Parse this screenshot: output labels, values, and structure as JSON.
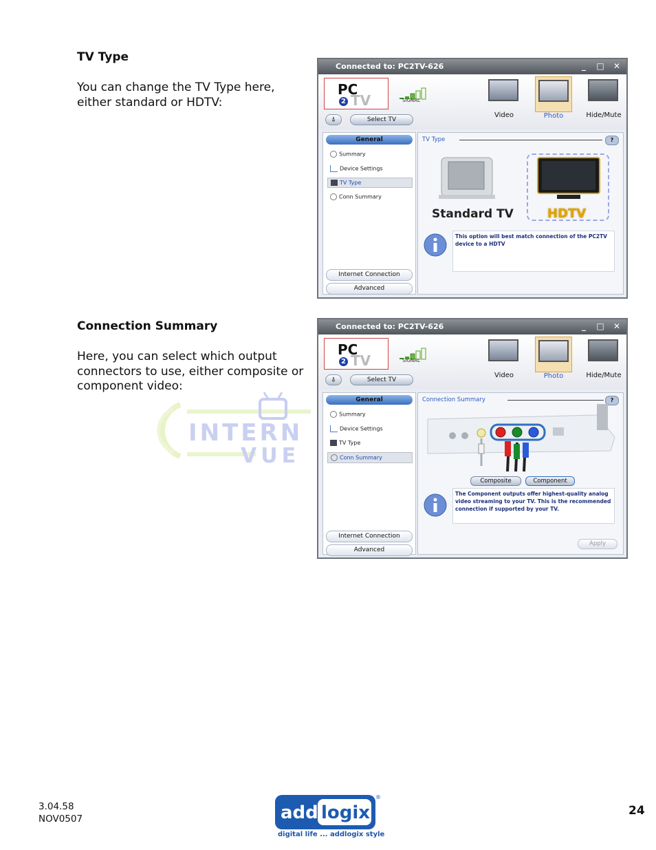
{
  "section1": {
    "heading": "TV Type",
    "lines": [
      "You can change the TV Type here,",
      "either standard or HDTV:"
    ]
  },
  "section2": {
    "heading": "Connection Summary",
    "lines": [
      "Here, you can select which output",
      "connectors to use, either composite or",
      "component video:"
    ]
  },
  "watermark": {
    "line1": "INTERN",
    "line2": "VUE"
  },
  "app": {
    "title": "Connected to: PC2TV-626",
    "window_buttons": {
      "minimize": "_",
      "maximize": "□",
      "close": "✕"
    },
    "logo": {
      "pc": "PC",
      "two": "2",
      "tv": "TV"
    },
    "signal_label": "SIGNAL",
    "select_tv": "Select TV",
    "modes": [
      "Video",
      "Photo",
      "Hide/Mute"
    ],
    "sidebar": {
      "general": "General",
      "items": [
        "Summary",
        "Device Settings",
        "TV Type",
        "Conn Summary"
      ],
      "bottom": [
        "Internet Connection",
        "Advanced"
      ]
    },
    "help": "?"
  },
  "tvtype_panel": {
    "title": "TV Type",
    "standard": "Standard TV",
    "hdtv": "HDTV",
    "info": "This option will best match connection of the PC2TV device to a HDTV"
  },
  "conn_panel": {
    "title": "Connection Summary",
    "composite": "Composite",
    "component": "Component",
    "info": "The Component outputs offer highest-quality analog video streaming to your TV.  This is the recommended connection if supported by your TV.",
    "apply": "Apply"
  },
  "footer": {
    "version": "3.04.58",
    "code": "NOV0507",
    "page": "24",
    "brand_add": "add",
    "brand_logix": "logix",
    "brand_reg": "®",
    "tagline": "digital life ... addlogix style"
  },
  "colors": {
    "accent": "#2c5bbf",
    "hdtv": "#e0a400",
    "watermark": "#c9d0f0",
    "watermark_green": "#e6f2c4"
  }
}
